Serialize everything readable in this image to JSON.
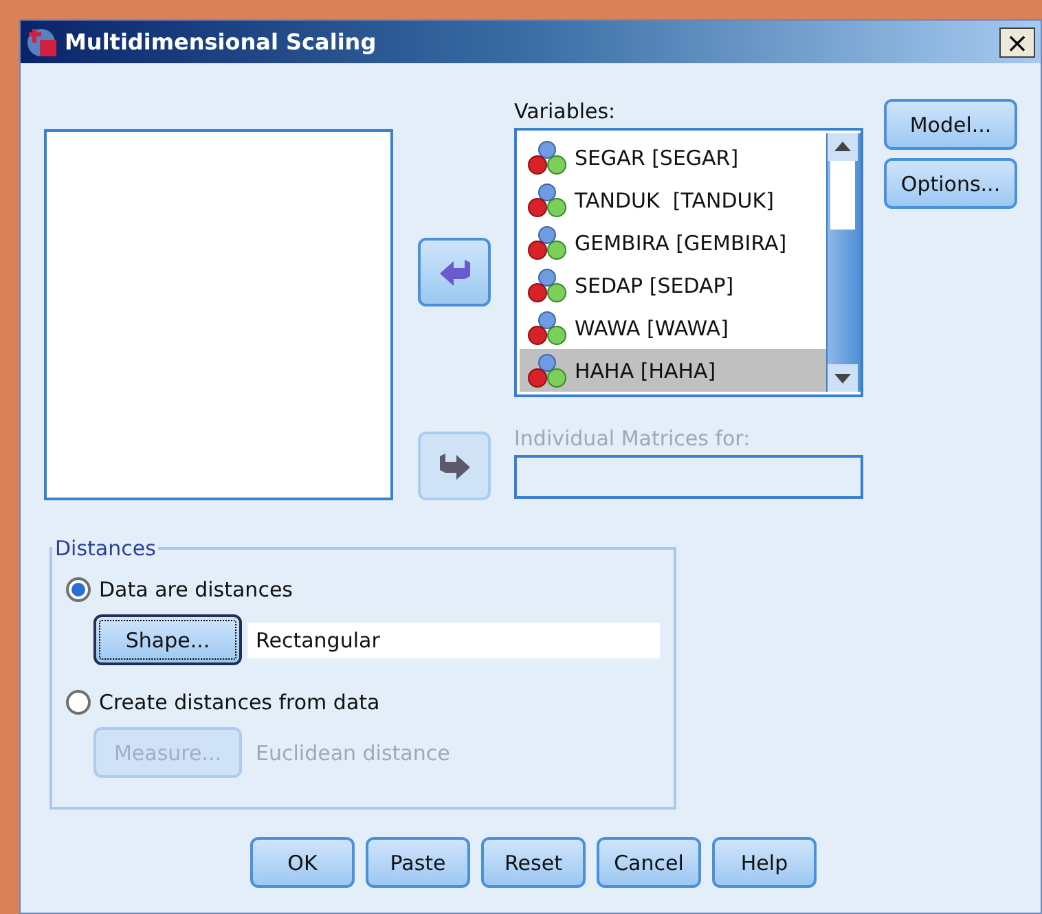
{
  "window": {
    "title": "Multidimensional Scaling",
    "close": "×"
  },
  "variables": {
    "label": "Variables:",
    "items": [
      {
        "label": "SEGAR [SEGAR]",
        "selected": false
      },
      {
        "label": "TANDUK  [TANDUK]",
        "selected": false
      },
      {
        "label": "GEMBIRA [GEMBIRA]",
        "selected": false
      },
      {
        "label": "SEDAP [SEDAP]",
        "selected": false
      },
      {
        "label": "WAWA [WAWA]",
        "selected": false
      },
      {
        "label": "HAHA [HAHA]",
        "selected": true
      }
    ]
  },
  "move_buttons": [
    {
      "kind": "left",
      "disabled": false
    },
    {
      "kind": "right",
      "disabled": true
    }
  ],
  "side_buttons": [
    "Model...",
    "Options..."
  ],
  "individual_matrices": {
    "label": "Individual Matrices for:",
    "disabled": true
  },
  "distances": {
    "title": "Distances",
    "options": [
      {
        "label": "Data are distances",
        "selected": true,
        "button": "Shape...",
        "button_disabled": false,
        "focused": true,
        "value": "Rectangular"
      },
      {
        "label": "Create distances from data",
        "selected": false,
        "button": "Measure...",
        "button_disabled": true,
        "focused": false,
        "value": "Euclidean distance"
      }
    ]
  },
  "buttons": [
    "OK",
    "Paste",
    "Reset",
    "Cancel",
    "Help"
  ]
}
